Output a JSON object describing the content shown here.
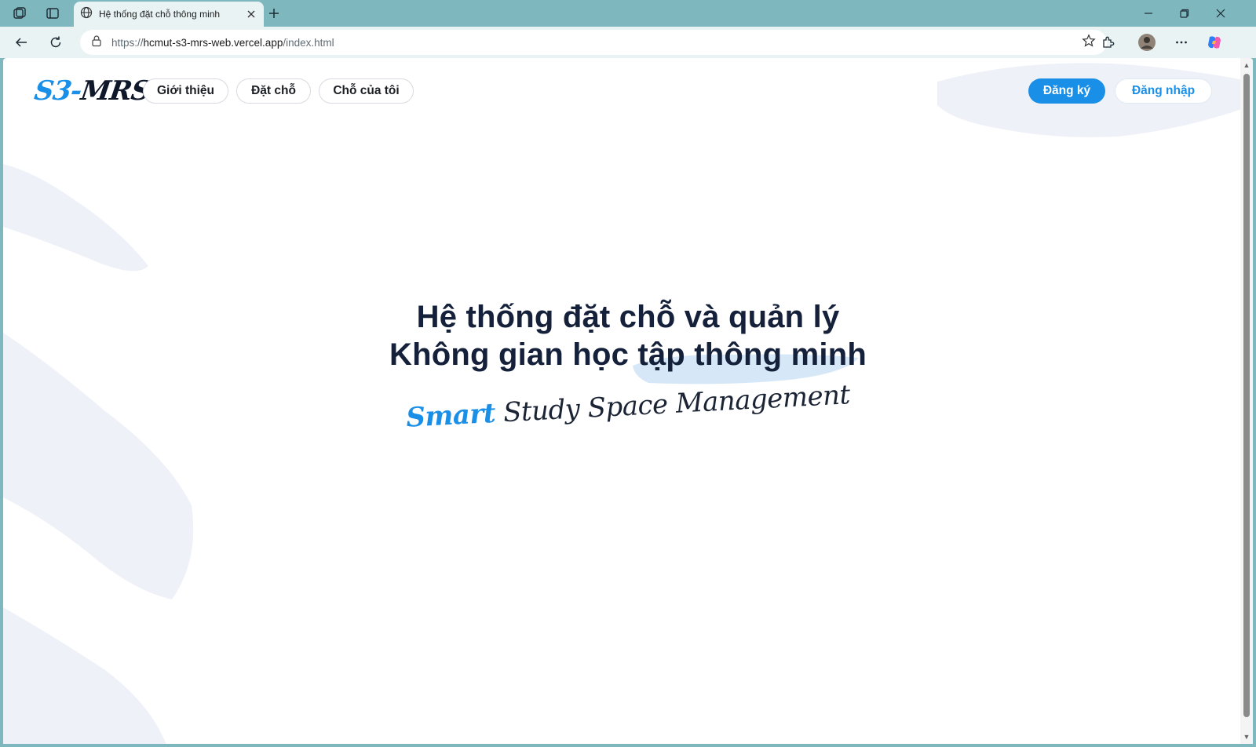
{
  "browser": {
    "tab_title": "Hệ thống đặt chỗ thông minh",
    "url_prefix": "https://",
    "url_host": "hcmut-s3-mrs-web.vercel.app",
    "url_path": "/index.html"
  },
  "header": {
    "logo_main": "S3-",
    "logo_accent": "MRS",
    "nav": [
      {
        "label": "Giới thiệu"
      },
      {
        "label": "Đặt chỗ"
      },
      {
        "label": "Chỗ của tôi"
      }
    ],
    "register_label": "Đăng ký",
    "login_label": "Đăng nhập"
  },
  "hero": {
    "line1": "Hệ thống đặt chỗ và quản lý",
    "line2": "Không gian học tập thông minh",
    "tagline_accent": "Smart",
    "tagline_rest": " Study Space Management"
  },
  "colors": {
    "accent": "#1a8fe8",
    "heading": "#15213a",
    "brush": "#eef2f8"
  }
}
